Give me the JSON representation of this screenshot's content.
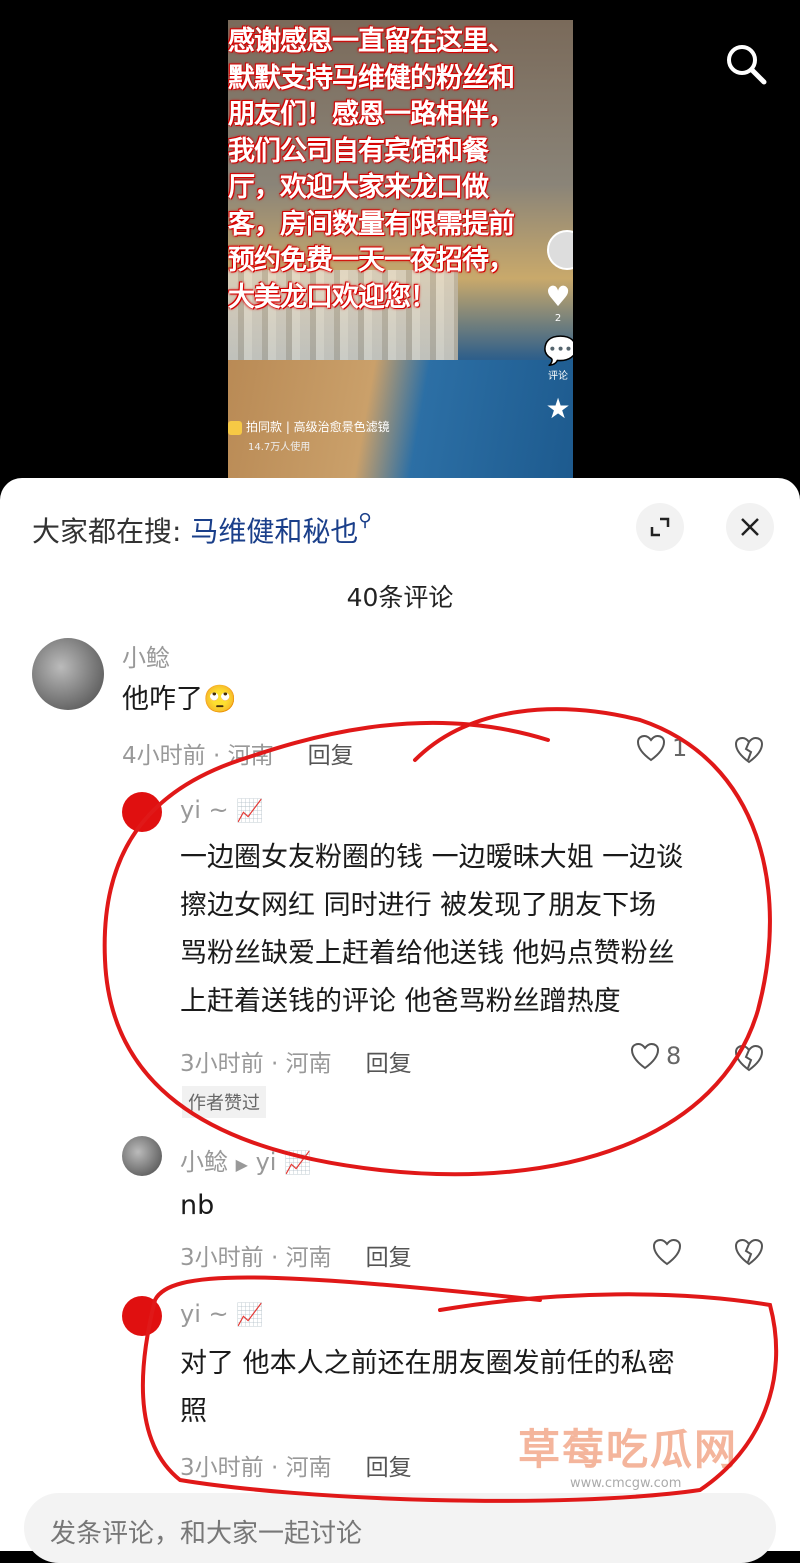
{
  "video": {
    "overlay_lines": [
      "感谢感恩一直留在这里、",
      "默默支持马维健的粉丝和",
      "朋友们！感恩一路相伴，",
      "我们公司自有宾馆和餐",
      "厅，欢迎大家来龙口做",
      "客，房间数量有限需提前",
      "预约免费一天一夜招待，",
      "大美龙口欢迎您！"
    ],
    "filter_label": "拍同款 | 高级治愈景色滤镜",
    "filter_users": "14.7万人使用",
    "side_like_count": "2",
    "side_comment_label": "评论"
  },
  "sheet": {
    "hot_label": "大家都在搜:",
    "hot_term": "马维健和秘也",
    "comment_count": "40条评论"
  },
  "comments": [
    {
      "user": "小鲶",
      "text": "他咋了",
      "emoji": "🙄",
      "time": "4小时前 · 河南",
      "reply": "回复",
      "likes": "1"
    },
    {
      "user": "yi ~",
      "text_lines": [
        "一边圈女友粉圈的钱  一边暧昧大姐 一边谈",
        "擦边女网红    同时进行  被发现了朋友下场",
        "骂粉丝缺爱上赶着给他送钱  他妈点赞粉丝",
        "上赶着送钱的评论  他爸骂粉丝蹭热度"
      ],
      "time": "3小时前 · 河南",
      "reply": "回复",
      "likes": "8",
      "badge": "作者赞过"
    },
    {
      "user": "小鲶",
      "reply_to": "yi",
      "text": "nb",
      "time": "3小时前 · 河南",
      "reply": "回复"
    },
    {
      "user": "yi ~",
      "text_lines": [
        "对了  他本人之前还在朋友圈发前任的私密",
        "照"
      ],
      "time": "3小时前 · 河南",
      "reply": "回复"
    }
  ],
  "input": {
    "placeholder": "发条评论，和大家一起讨论"
  },
  "watermark": {
    "title": "草莓吃瓜网",
    "url": "www.cmcgw.com"
  },
  "colors": {
    "annotation": "#e01818",
    "link": "#1a3f8a",
    "overlay_text_shadow": "#d00000"
  }
}
